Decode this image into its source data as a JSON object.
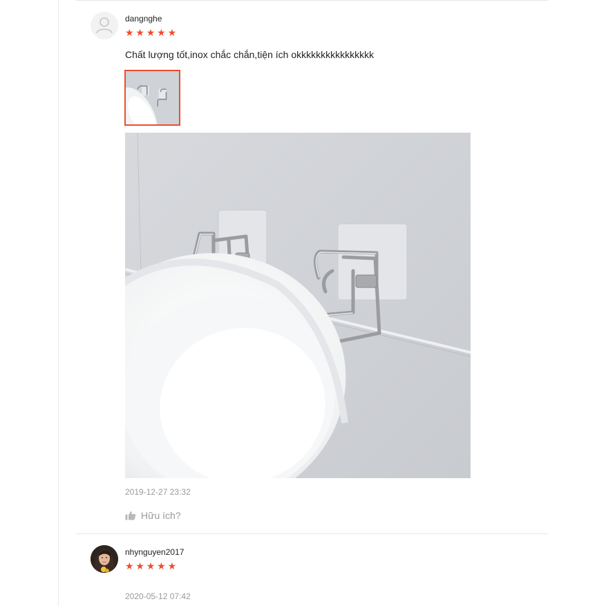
{
  "reviews": [
    {
      "username": "dangnghe",
      "rating": 5,
      "stars": [
        "★",
        "★",
        "★",
        "★",
        "★"
      ],
      "comment": "Chất lượng tốt,inox chắc chắn,tiện ích okkkkkkkkkkkkkkkk",
      "timestamp": "2019-12-27 23:32",
      "helpful_label": "Hữu ích?",
      "avatar": "default-user-icon"
    },
    {
      "username": "nhynguyen2017",
      "rating": 5,
      "stars": [
        "★",
        "★",
        "★",
        "★",
        "★"
      ],
      "timestamp": "2020-05-12 07:42",
      "avatar": "user-photo"
    }
  ],
  "colors": {
    "accent": "#ee4d2d",
    "muted_text": "#999999",
    "divider": "#e6e6e6"
  }
}
